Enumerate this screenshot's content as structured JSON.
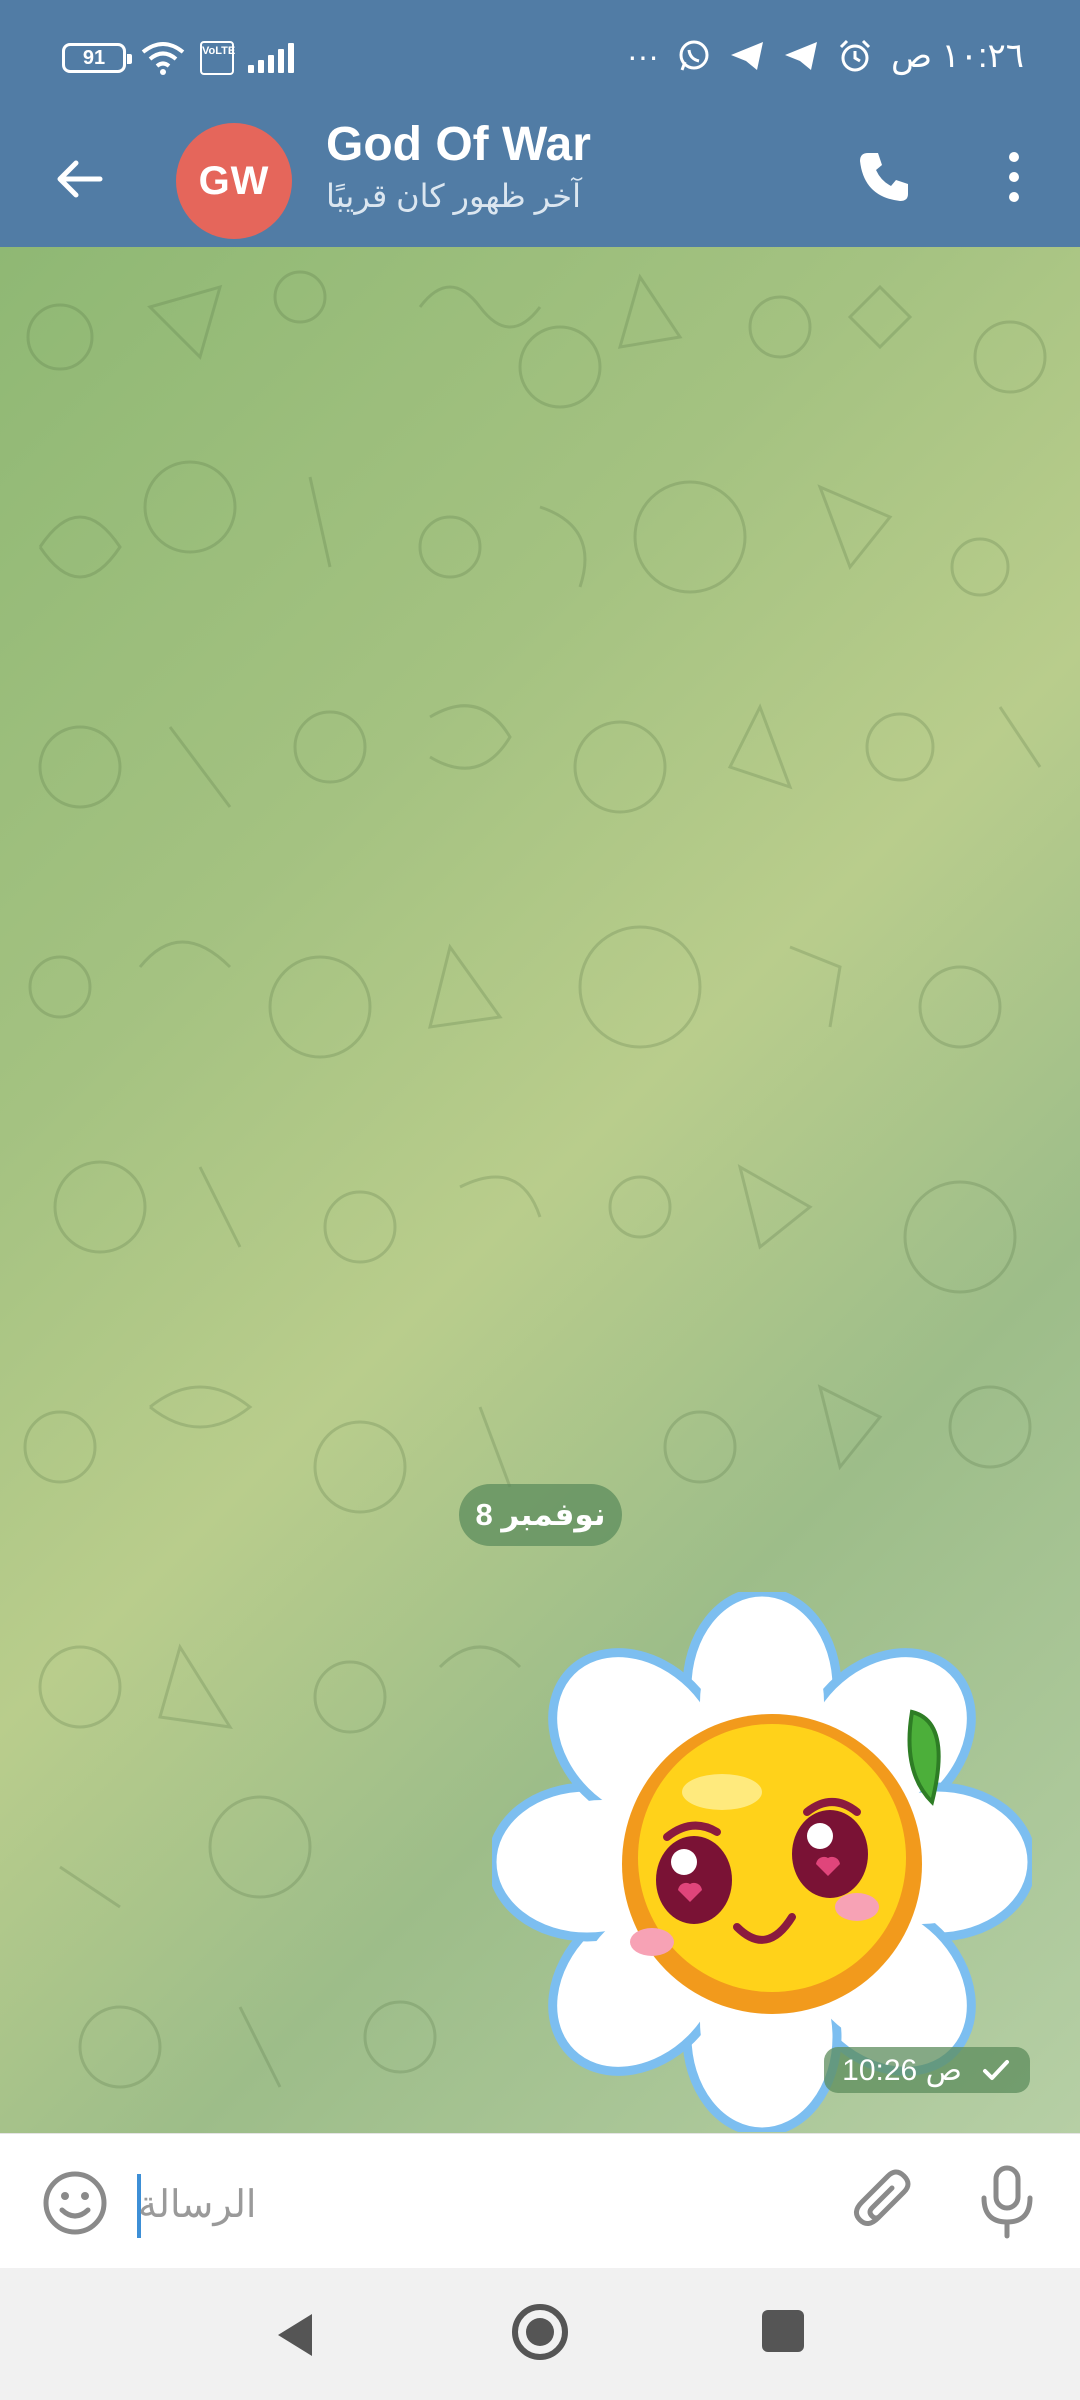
{
  "status_bar": {
    "battery": "91",
    "network": "VoLTE",
    "time": "١٠:٢٦ ص",
    "more": "···"
  },
  "header": {
    "avatar_initials": "GW",
    "avatar_color": "#e5665b",
    "title": "God Of War",
    "status": "آخر ظهور كان قريبًا",
    "bar_color": "#517ca5"
  },
  "chat": {
    "date_separator": "8 نوفمبر",
    "message": {
      "type": "sticker",
      "sticker_icon": "daisy-face-sticker",
      "time": "10:26 ص",
      "status": "sent-check"
    }
  },
  "composer": {
    "placeholder": "الرسالة",
    "value": ""
  },
  "icons": {
    "back": "arrow-left-icon",
    "call": "phone-icon",
    "menu": "more-vertical-icon",
    "emoji": "emoji-icon",
    "attach": "paperclip-icon",
    "mic": "microphone-icon"
  }
}
